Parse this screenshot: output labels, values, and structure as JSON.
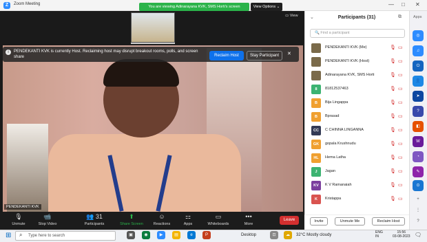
{
  "window": {
    "title": "Zoom Meeting",
    "logo": "Z"
  },
  "banner": {
    "viewing_text": "You are viewing Adinarayana KVK, SMS Horti's screen",
    "view_options": "View Options ⌄"
  },
  "window_controls": [
    "—",
    "□",
    "✕"
  ],
  "share_view": {
    "view_label": "▭ View"
  },
  "host_notice": {
    "text": "PENDEKANTI KVK is currently Host. Reclaiming host may disrupt breakout rooms, polls, and screen share",
    "reclaim_label": "Reclaim Host",
    "stay_label": "Stay Participant",
    "close": "✕"
  },
  "video": {
    "name_tag": "PENDEKANTI KVK"
  },
  "toolbar": {
    "items": [
      {
        "icon": "🎙",
        "label": "Unmute"
      },
      {
        "icon": "📹",
        "label": "Stop Video"
      },
      {
        "icon": "👥 31",
        "label": "Participants"
      },
      {
        "icon": "⬆",
        "label": "Share Screen"
      },
      {
        "icon": "☺",
        "label": "Reactions"
      },
      {
        "icon": "⚏",
        "label": "Apps"
      },
      {
        "icon": "▭",
        "label": "Whiteboards"
      },
      {
        "icon": "•••",
        "label": "More"
      }
    ],
    "leave_label": "Leave"
  },
  "panel": {
    "title": "Participants (31)",
    "search_placeholder": "🔍 Find a participant",
    "participants": [
      {
        "initials": "",
        "name": "PENDEKANTI KVK (Me)",
        "color": "#7a6a4a"
      },
      {
        "initials": "",
        "name": "PENDEKANTI KVK (Host)",
        "color": "#7a6a4a"
      },
      {
        "initials": "",
        "name": "Adinarayana KVK, SMS Horti",
        "color": "#7a6a4a"
      },
      {
        "initials": "8",
        "name": "81812537463",
        "color": "#3cb371"
      },
      {
        "initials": "B",
        "name": "Bija Lingappa",
        "color": "#f0a030"
      },
      {
        "initials": "B",
        "name": "Bprasad",
        "color": "#f0a030"
      },
      {
        "initials": "CC",
        "name": "C CHINNA LINGANNA",
        "color": "#333a55"
      },
      {
        "initials": "GK",
        "name": "gopala Krushnudu",
        "color": "#f0a030"
      },
      {
        "initials": "HL",
        "name": "Hema Latha",
        "color": "#f0a030"
      },
      {
        "initials": "J",
        "name": "Jagan",
        "color": "#3cb371"
      },
      {
        "initials": "KV",
        "name": "K V Ramanaiah",
        "color": "#7b3f9e"
      },
      {
        "initials": "K",
        "name": "Kristappa",
        "color": "#d9534f"
      }
    ],
    "invite_label": "Invite",
    "unmute_me_label": "Unmute Me",
    "reclaim_host_label": "Reclaim Host"
  },
  "apps_rail": {
    "label": "Apps"
  },
  "taskbar": {
    "search_placeholder": "Type here to search",
    "desktop_label": "Desktop",
    "weather": "32°C  Mostly cloudy",
    "lang_top": "ENG",
    "lang_bottom": "IN",
    "time": "15:56",
    "date": "03-08-2023"
  }
}
